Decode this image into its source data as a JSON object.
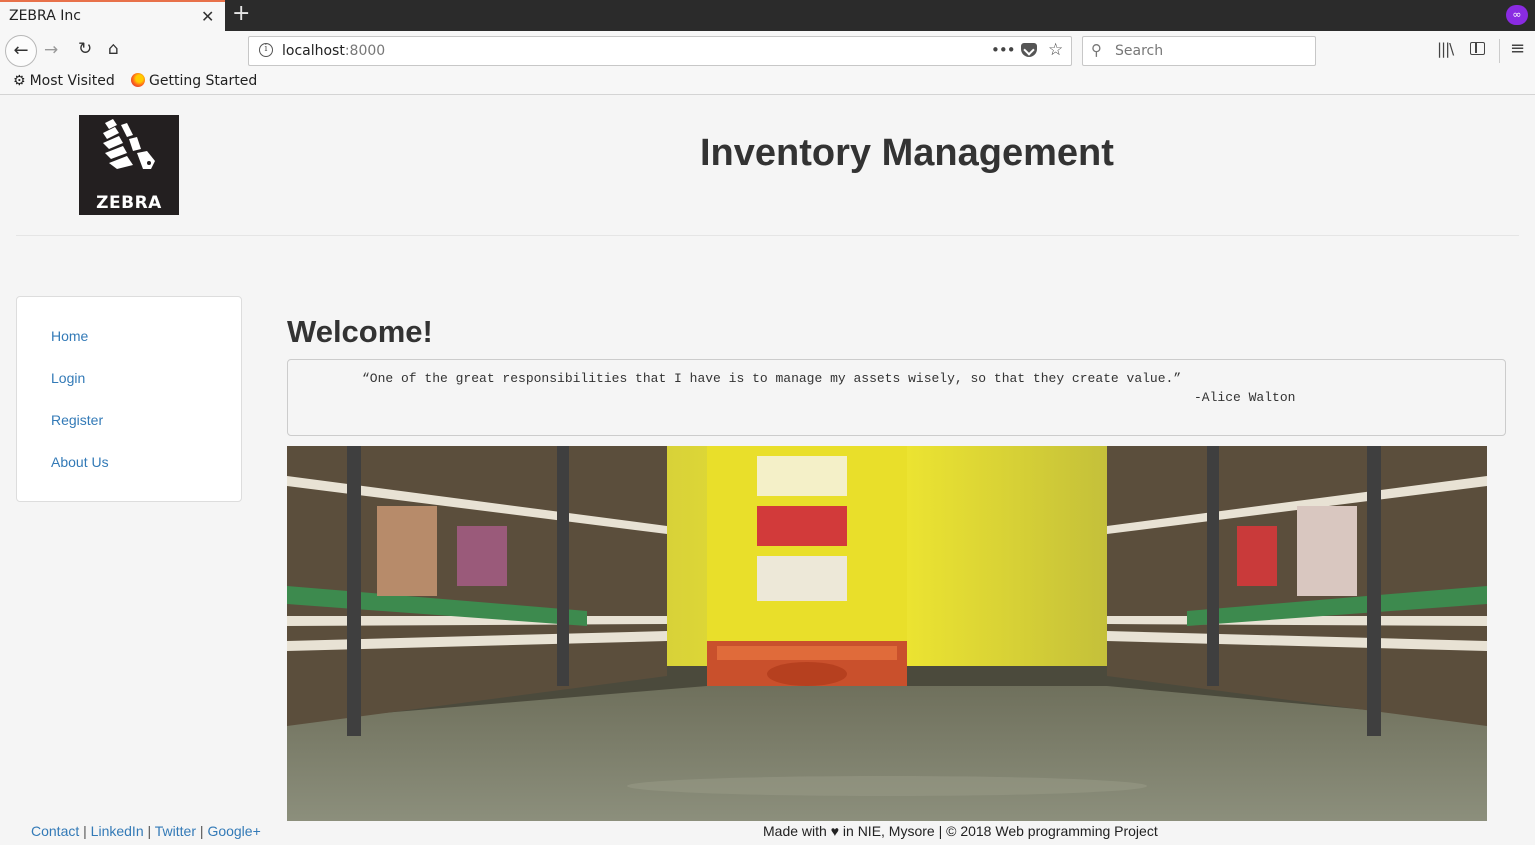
{
  "browser": {
    "tab_title": "ZEBRA Inc",
    "tab_close": "✕",
    "new_tab": "+",
    "url_host": "localhost",
    "url_port": ":8000",
    "url_more": "•••",
    "search_placeholder": "Search",
    "bookmarks": [
      {
        "label": "Most Visited",
        "icon": "gear-icon"
      },
      {
        "label": "Getting Started",
        "icon": "firefox-icon"
      }
    ]
  },
  "header": {
    "logo_text": "ZEBRA",
    "title": "Inventory Management"
  },
  "sidebar": {
    "items": [
      {
        "label": "Home"
      },
      {
        "label": "Login"
      },
      {
        "label": "Register"
      },
      {
        "label": "About Us"
      }
    ]
  },
  "main": {
    "heading": "Welcome!",
    "quote": "“One of the great responsibilities that I have is to manage my assets wisely, so that they create value.”",
    "quote_author": "-Alice Walton",
    "hero_image": "warehouse-aisle-robot-image"
  },
  "footer": {
    "links": [
      "Contact",
      "LinkedIn",
      "Twitter",
      "Google+"
    ],
    "separator": "|",
    "credit_prefix": "Made with",
    "credit_suffix": "in NIE, Mysore | © 2018 Web programming Project"
  },
  "colors": {
    "link": "#337ab7",
    "tab_accent": "#e8714a",
    "logo_bg": "#231f20"
  }
}
